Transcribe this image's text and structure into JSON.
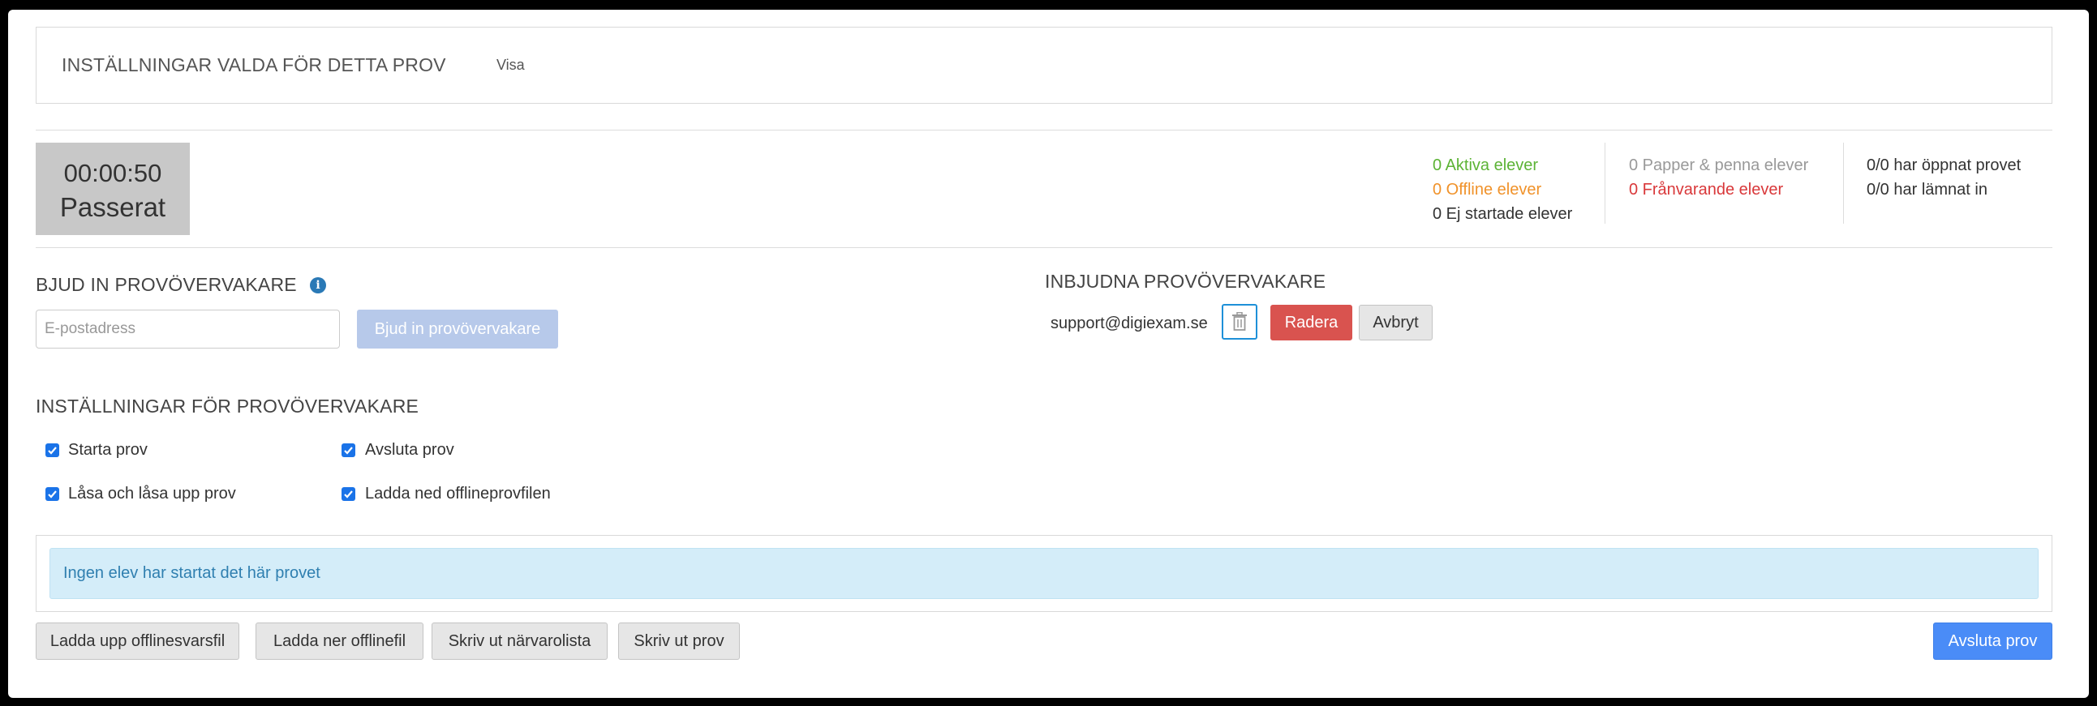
{
  "settings_panel": {
    "title": "INSTÄLLNINGAR VALDA FÖR DETTA PROV",
    "toggle_link": "Visa"
  },
  "timer": {
    "time": "00:00:50",
    "label": "Passerat"
  },
  "stats": {
    "active": "0 Aktiva elever",
    "offline": "0 Offline elever",
    "not_started": "0 Ej startade elever",
    "paper": "0 Papper & penna elever",
    "absent": "0 Frånvarande elever",
    "opened": "0/0 har öppnat provet",
    "submitted": "0/0 har lämnat in"
  },
  "invite": {
    "heading": "BJUD IN PROVÖVERVAKARE",
    "email_placeholder": "E-postadress",
    "button": "Bjud in provövervakare"
  },
  "invited": {
    "heading": "INBJUDNA PROVÖVERVAKARE",
    "email": "support@digiexam.se",
    "delete_button": "Radera",
    "cancel_button": "Avbryt"
  },
  "supervisor_settings": {
    "heading": "INSTÄLLNINGAR FÖR PROVÖVERVAKARE",
    "options": [
      {
        "label": "Starta prov",
        "checked": true
      },
      {
        "label": "Avsluta prov",
        "checked": true
      },
      {
        "label": "Låsa och låsa upp prov",
        "checked": true
      },
      {
        "label": "Ladda ned offlineprovfilen",
        "checked": true
      }
    ]
  },
  "alert": {
    "message": "Ingen elev har startat det här provet"
  },
  "footer": {
    "upload_answers": "Ladda upp offlinesvarsfil",
    "download_offline": "Ladda ner offlinefil",
    "print_attendance": "Skriv ut närvarolista",
    "print_exam": "Skriv ut prov",
    "end_exam": "Avsluta prov"
  },
  "colors": {
    "active": "#5cb335",
    "offline": "#f0922a",
    "paper": "#999999",
    "absent": "#d9383a",
    "primary": "#4a8cf7",
    "danger": "#d9534f"
  }
}
